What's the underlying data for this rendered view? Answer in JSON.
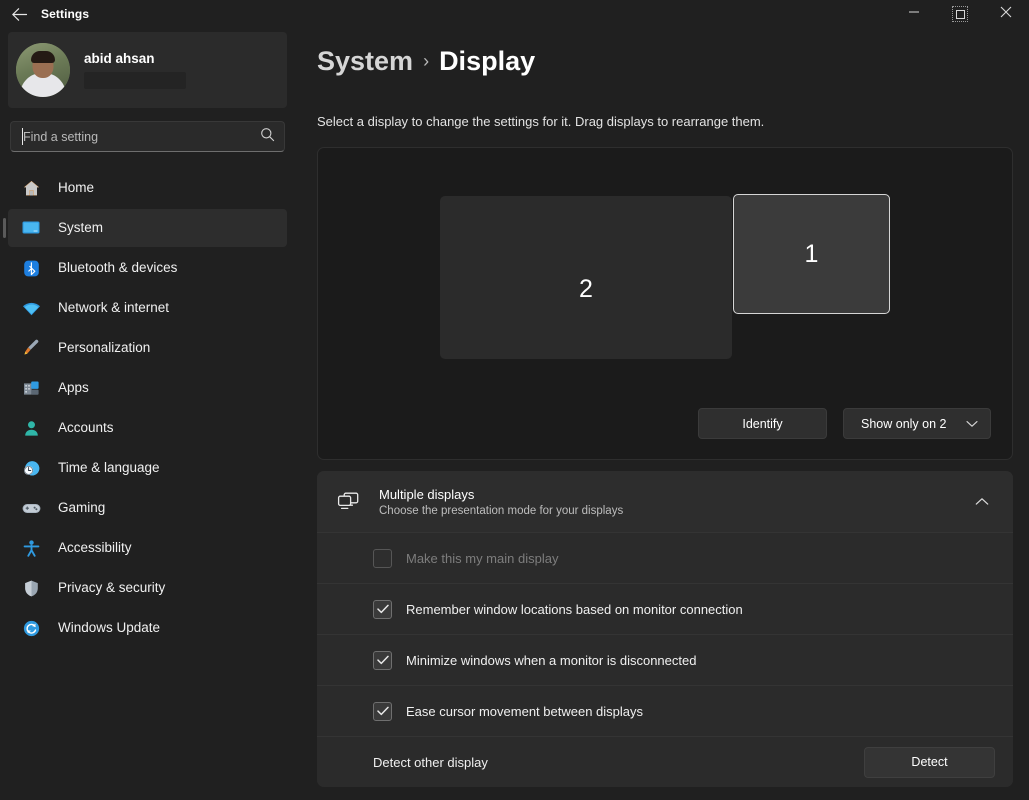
{
  "window": {
    "title": "Settings",
    "back_icon": "back-arrow-icon",
    "minimize_label": "—",
    "maximize_label": "□",
    "close_label": "✕"
  },
  "sidebar": {
    "profile": {
      "name": "abid ahsan",
      "email_redacted": true
    },
    "search": {
      "placeholder": "Find a setting",
      "value": "",
      "icon": "search-icon"
    },
    "items": [
      {
        "label": "Home",
        "icon": "home-icon",
        "selected": false
      },
      {
        "label": "System",
        "icon": "system-monitor-icon",
        "selected": true
      },
      {
        "label": "Bluetooth & devices",
        "icon": "bluetooth-icon",
        "selected": false
      },
      {
        "label": "Network & internet",
        "icon": "wifi-icon",
        "selected": false
      },
      {
        "label": "Personalization",
        "icon": "paintbrush-icon",
        "selected": false
      },
      {
        "label": "Apps",
        "icon": "apps-grid-icon",
        "selected": false
      },
      {
        "label": "Accounts",
        "icon": "person-icon",
        "selected": false
      },
      {
        "label": "Time & language",
        "icon": "clock-globe-icon",
        "selected": false
      },
      {
        "label": "Gaming",
        "icon": "gamepad-icon",
        "selected": false
      },
      {
        "label": "Accessibility",
        "icon": "accessibility-person-icon",
        "selected": false
      },
      {
        "label": "Privacy & security",
        "icon": "shield-icon",
        "selected": false
      },
      {
        "label": "Windows Update",
        "icon": "update-refresh-icon",
        "selected": false
      }
    ]
  },
  "main": {
    "breadcrumb": {
      "parent": "System",
      "separator": "›",
      "current": "Display"
    },
    "hint": "Select a display to change the settings for it. Drag displays to rearrange them.",
    "arrangement": {
      "monitors": [
        {
          "number": "2",
          "selected": false
        },
        {
          "number": "1",
          "selected": true
        }
      ],
      "identify_label": "Identify",
      "mode_dropdown": {
        "value": "Show only on 2",
        "icon": "chevron-down-icon"
      }
    },
    "multiple_displays": {
      "icon": "multiple-displays-icon",
      "title": "Multiple displays",
      "subtitle": "Choose the presentation mode for your displays",
      "expanded": true,
      "collapse_icon": "chevron-up-icon",
      "options": [
        {
          "label": "Make this my main display",
          "checked": false,
          "disabled": true
        },
        {
          "label": "Remember window locations based on monitor connection",
          "checked": true,
          "disabled": false
        },
        {
          "label": "Minimize windows when a monitor is disconnected",
          "checked": true,
          "disabled": false
        },
        {
          "label": "Ease cursor movement between displays",
          "checked": true,
          "disabled": false
        }
      ],
      "detect_row": {
        "label": "Detect other display",
        "button_label": "Detect"
      }
    }
  },
  "colors": {
    "window_bg": "#202020",
    "card_bg": "#2b2b2b",
    "arrange_bg": "#1b1b1b",
    "selected_nav_bg": "#2d2d2d",
    "monitor_selected": "#3b3b3b",
    "monitor_unselected": "#2b2b2b",
    "accent_blue": "#2f9ae0"
  }
}
